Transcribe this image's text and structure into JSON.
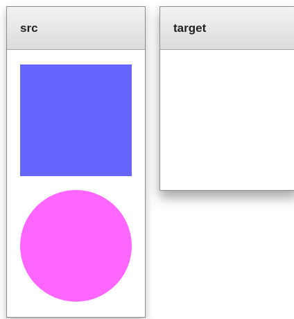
{
  "panels": {
    "src": {
      "title": "src",
      "shapes": [
        {
          "kind": "square",
          "color": "#6666ff"
        },
        {
          "kind": "circle",
          "color": "#ff66ff"
        }
      ]
    },
    "target": {
      "title": "target"
    }
  },
  "colors": {
    "square": "#6666ff",
    "circle": "#ff66ff"
  }
}
